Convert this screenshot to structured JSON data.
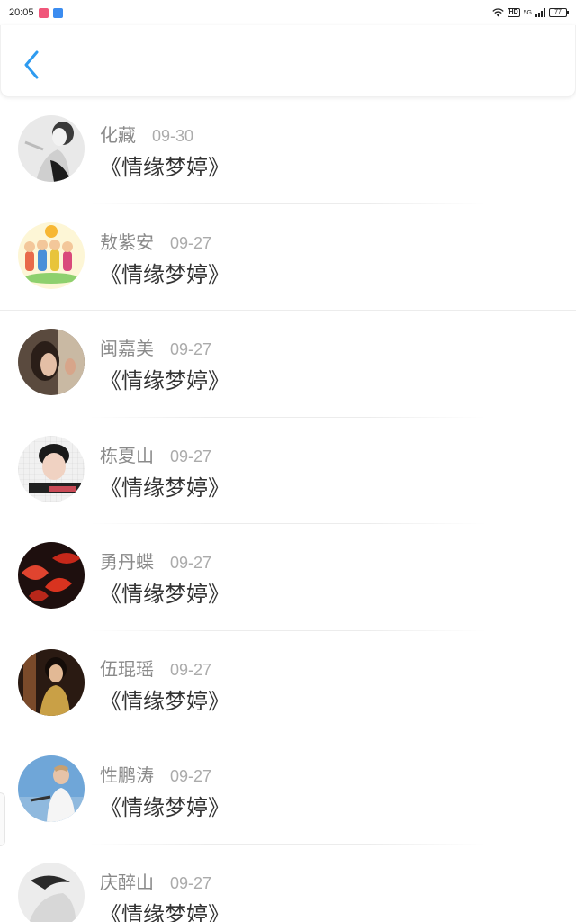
{
  "status_bar": {
    "time": "20:05",
    "network_label": "HD",
    "signal_label": "5G",
    "battery": "77"
  },
  "nav": {
    "back_icon": "chevron-left-icon",
    "accent_color": "#2e9bf0"
  },
  "items": [
    {
      "name": "化藏",
      "date": "09-30",
      "title": "《情缘梦婷》"
    },
    {
      "name": "敖紫安",
      "date": "09-27",
      "title": "《情缘梦婷》"
    },
    {
      "name": "闽嘉美",
      "date": "09-27",
      "title": "《情缘梦婷》"
    },
    {
      "name": "栋夏山",
      "date": "09-27",
      "title": "《情缘梦婷》"
    },
    {
      "name": "勇丹蝶",
      "date": "09-27",
      "title": "《情缘梦婷》"
    },
    {
      "name": "伍琨瑶",
      "date": "09-27",
      "title": "《情缘梦婷》"
    },
    {
      "name": "性鹏涛",
      "date": "09-27",
      "title": "《情缘梦婷》"
    },
    {
      "name": "庆醉山",
      "date": "09-27",
      "title": "《情缘梦婷》"
    }
  ]
}
